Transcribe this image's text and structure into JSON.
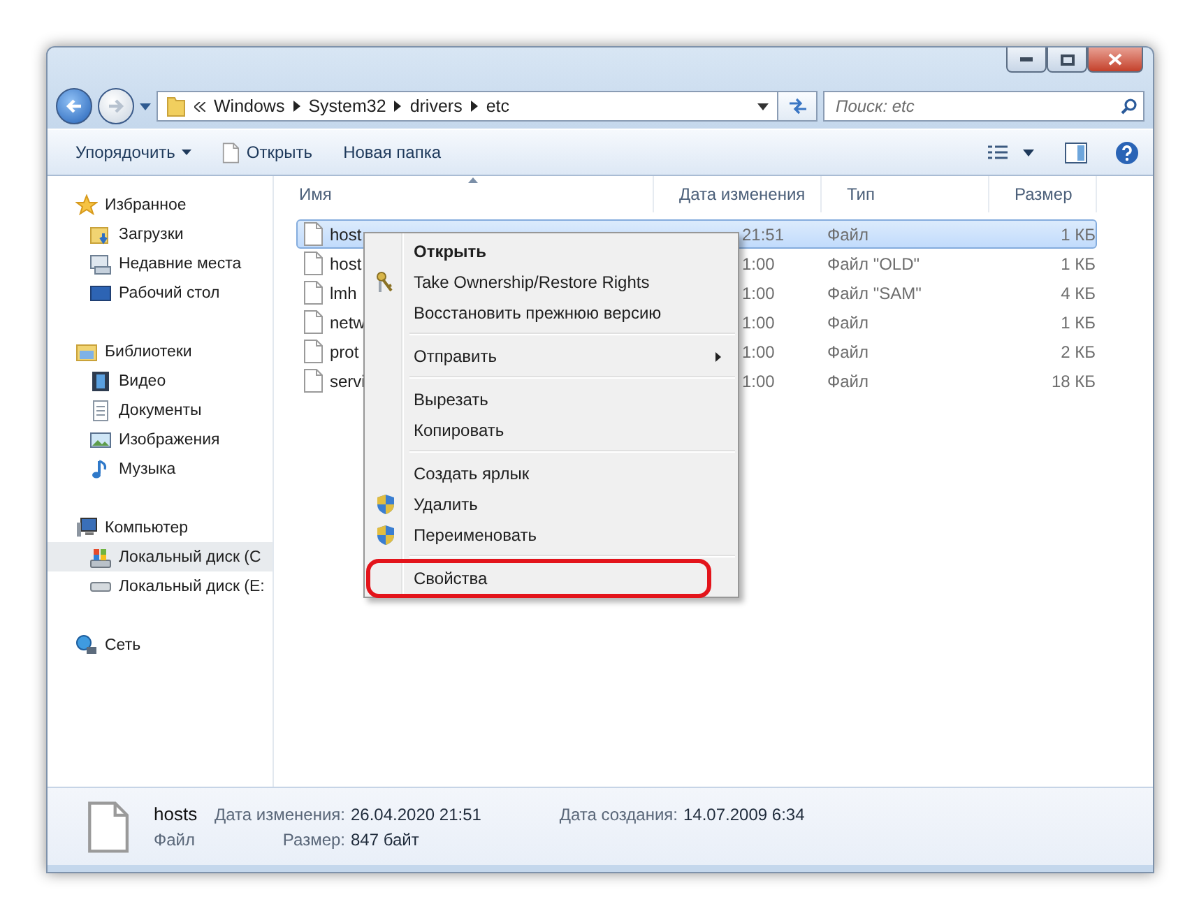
{
  "address_bar": {
    "breadcrumb": [
      "Windows",
      "System32",
      "drivers",
      "etc"
    ]
  },
  "search": {
    "placeholder": "Поиск: etc"
  },
  "toolbar": {
    "buttons": [
      {
        "label": "Упорядочить",
        "kind": "dropdown"
      },
      {
        "label": "Открыть",
        "kind": "file"
      },
      {
        "label": "Новая папка",
        "kind": "plain"
      }
    ]
  },
  "sidebar": {
    "groups": [
      {
        "label": "Избранное",
        "kind": "star",
        "selected": false,
        "children": [
          {
            "label": "Загрузки",
            "kind": "downloads",
            "selected": false
          },
          {
            "label": "Недавние места",
            "kind": "recent",
            "selected": false
          },
          {
            "label": "Рабочий стол",
            "kind": "desktop",
            "selected": false
          }
        ]
      },
      {
        "label": "Библиотеки",
        "kind": "libraries",
        "selected": false,
        "children": [
          {
            "label": "Видео",
            "kind": "video",
            "selected": false
          },
          {
            "label": "Документы",
            "kind": "documents",
            "selected": false
          },
          {
            "label": "Изображения",
            "kind": "pictures",
            "selected": false
          },
          {
            "label": "Музыка",
            "kind": "music",
            "selected": false
          }
        ]
      },
      {
        "label": "Компьютер",
        "kind": "computer",
        "selected": false,
        "children": [
          {
            "label": "Локальный диск (C",
            "kind": "system-drive",
            "selected": true
          },
          {
            "label": "Локальный диск (E:",
            "kind": "drive",
            "selected": false
          }
        ]
      },
      {
        "label": "Сеть",
        "kind": "network",
        "selected": false
      }
    ]
  },
  "table": {
    "columns": [
      "Имя",
      "Дата изменения",
      "Тип",
      "Размер"
    ],
    "rows": [
      {
        "name": "host",
        "modified": "21:51",
        "type": "Файл",
        "size": "1 КБ",
        "selected": true
      },
      {
        "name": "host",
        "modified": "1:00",
        "type": "Файл \"OLD\"",
        "size": "1 КБ",
        "selected": false
      },
      {
        "name": "lmh",
        "modified": "1:00",
        "type": "Файл \"SAM\"",
        "size": "4 КБ",
        "selected": false
      },
      {
        "name": "netw",
        "modified": "1:00",
        "type": "Файл",
        "size": "1 КБ",
        "selected": false
      },
      {
        "name": "prot",
        "modified": "1:00",
        "type": "Файл",
        "size": "2 КБ",
        "selected": false
      },
      {
        "name": "servi",
        "modified": "1:00",
        "type": "Файл",
        "size": "18 КБ",
        "selected": false
      }
    ]
  },
  "context_menu": {
    "items": [
      {
        "kind": "item",
        "label": "Открыть",
        "default": true
      },
      {
        "kind": "keys",
        "label": "Take Ownership/Restore Rights",
        "default": false
      },
      {
        "kind": "item",
        "label": "Восстановить прежнюю версию",
        "default": false
      },
      {
        "kind": "separator"
      },
      {
        "kind": "submenu",
        "label": "Отправить",
        "default": false
      },
      {
        "kind": "separator"
      },
      {
        "kind": "item",
        "label": "Вырезать",
        "default": false
      },
      {
        "kind": "item",
        "label": "Копировать",
        "default": false
      },
      {
        "kind": "separator"
      },
      {
        "kind": "item",
        "label": "Создать ярлык",
        "default": false
      },
      {
        "kind": "shield",
        "label": "Удалить",
        "default": false
      },
      {
        "kind": "shield",
        "label": "Переименовать",
        "default": false
      },
      {
        "kind": "separator"
      },
      {
        "kind": "item",
        "label": "Свойства",
        "default": false,
        "annotated": true
      }
    ]
  },
  "details": {
    "name": "hosts",
    "type": "Файл",
    "fields": [
      {
        "label": "Дата изменения:",
        "value": "26.04.2020 21:51"
      },
      {
        "label": "Дата создания:",
        "value": "14.07.2009 6:34"
      },
      {
        "label": "Размер:",
        "value": "847 байт"
      }
    ]
  }
}
